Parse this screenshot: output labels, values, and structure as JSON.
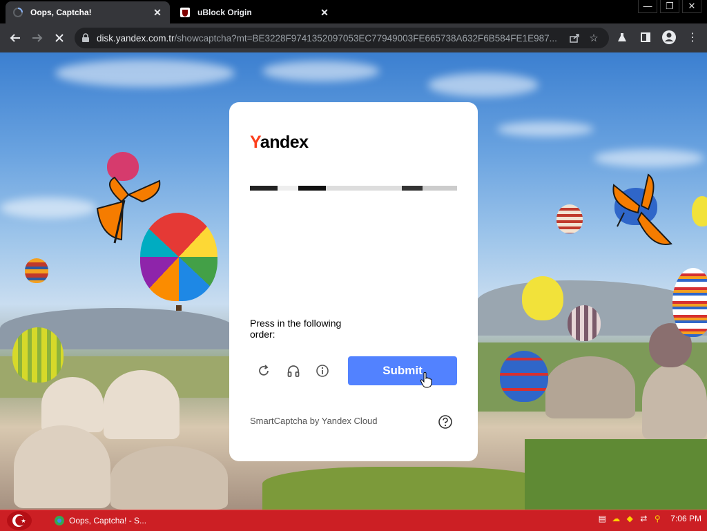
{
  "browser": {
    "tabs": [
      {
        "title": "Oops, Captcha!",
        "active": true,
        "icon": "loading-spinner-icon"
      },
      {
        "title": "uBlock Origin",
        "active": false,
        "icon": "ublock-icon"
      }
    ],
    "url_host": "disk.yandex.com.tr",
    "url_path": "/showcaptcha?mt=BE3228F9741352097053EC77949003FE665738A632F6B584FE1E987..."
  },
  "captcha": {
    "logo_first": "Y",
    "logo_rest": "andex",
    "instruction": "Press in the following order:",
    "submit_label": "Submit",
    "footer": "SmartCaptcha by Yandex Cloud",
    "colors": {
      "submit": "#5282ff",
      "logo_accent": "#fc3f1d"
    }
  },
  "taskbar": {
    "item_label": "Oops, Captcha! - S...",
    "clock": "7:06 PM",
    "color": "#cc1f24"
  }
}
